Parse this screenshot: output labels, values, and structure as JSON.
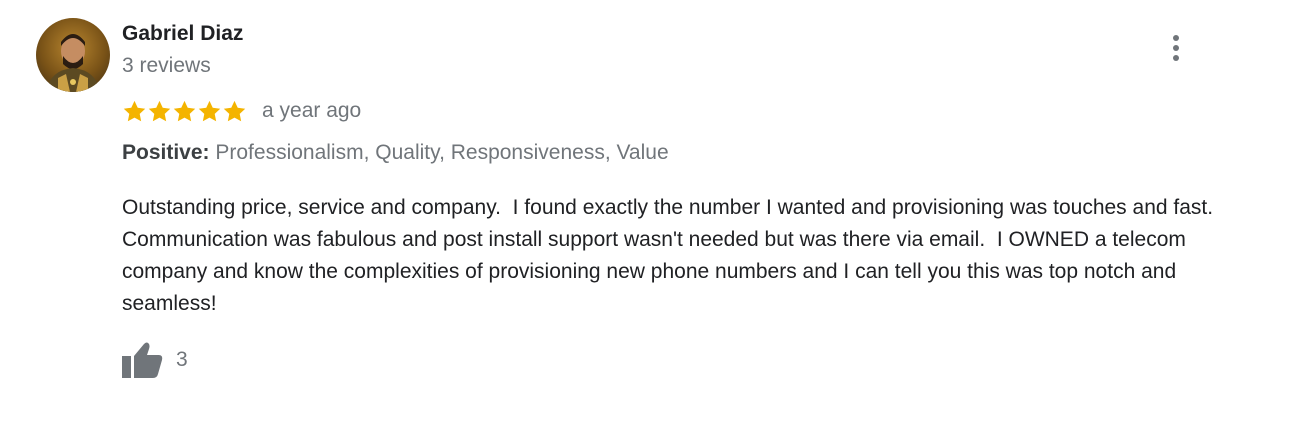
{
  "review": {
    "author": {
      "name": "Gabriel Diaz",
      "meta": "3 reviews"
    },
    "rating": {
      "value": 5,
      "max": 5,
      "star_color": "#f4b400"
    },
    "time_ago": "a year ago",
    "attributes": {
      "label": "Positive:",
      "values": "Professionalism, Quality, Responsiveness, Value"
    },
    "text": "Outstanding price, service and company.  I found exactly the number I wanted and provisioning was touches and fast.  Communication was fabulous and post install support wasn't needed but was there via email.  I OWNED a telecom company and know the complexities of provisioning new phone numbers and I can tell you this was top notch and seamless!",
    "likes": {
      "count": "3",
      "icon": "thumbs-up-icon"
    },
    "more_menu": {
      "icon": "more-vert-icon"
    }
  },
  "colors": {
    "primary_text": "#202124",
    "secondary_text": "#70757a",
    "star": "#f4b400",
    "icon": "#70757a"
  }
}
